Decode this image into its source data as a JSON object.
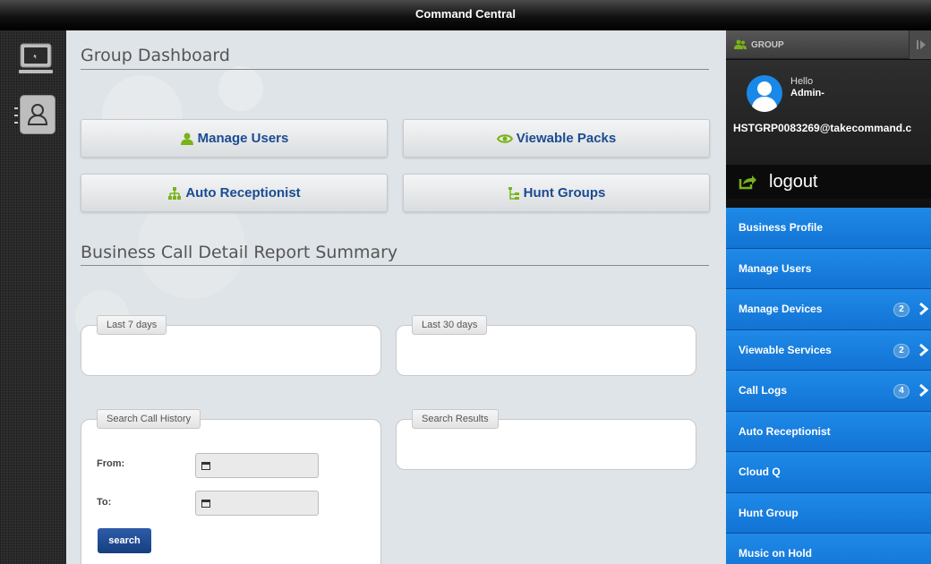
{
  "window": {
    "title": "Command Central"
  },
  "left_rail": {
    "items": [
      {
        "icon": "monitor-icon"
      },
      {
        "icon": "contacts-icon"
      }
    ]
  },
  "dashboard": {
    "title": "Group Dashboard",
    "buttons": [
      {
        "label": "Manage Users",
        "icon": "user-icon",
        "color": "#1a4b93",
        "icon_color": "#7ab317"
      },
      {
        "label": "Viewable Packs",
        "icon": "eye-icon",
        "color": "#1a4b93",
        "icon_color": "#7ab317"
      },
      {
        "label": "Auto Receptionist",
        "icon": "org-chart-icon",
        "color": "#1a4b93",
        "icon_color": "#7ab317"
      },
      {
        "label": "Hunt Groups",
        "icon": "hierarchy-icon",
        "color": "#1a4b93",
        "icon_color": "#7ab317"
      }
    ]
  },
  "report": {
    "title": "Business Call Detail Report Summary",
    "last7_label": "Last 7 days",
    "last30_label": "Last 30 days",
    "search_history_label": "Search Call History",
    "search_results_label": "Search Results",
    "from_label": "From:",
    "to_label": "To:",
    "search_button": "search"
  },
  "sidebar": {
    "group_label": "GROUP",
    "hello": "Hello",
    "user_name": "Admin-",
    "email": "HSTGRP0083269@takecommand.c",
    "logout_label": "logout",
    "items": [
      {
        "label": "Business Profile",
        "badge": null
      },
      {
        "label": "Manage Users",
        "badge": null
      },
      {
        "label": "Manage Devices",
        "badge": "2"
      },
      {
        "label": "Viewable Services",
        "badge": "2"
      },
      {
        "label": "Call Logs",
        "badge": "4"
      },
      {
        "label": "Auto Receptionist",
        "badge": null
      },
      {
        "label": "Cloud Q",
        "badge": null
      },
      {
        "label": "Hunt Group",
        "badge": null
      },
      {
        "label": "Music on Hold",
        "badge": null
      }
    ]
  },
  "colors": {
    "menu_blue": "#1a7ee0",
    "button_text_blue": "#1a4b93",
    "icon_green": "#7ab317",
    "search_button": "#1f4d96"
  }
}
